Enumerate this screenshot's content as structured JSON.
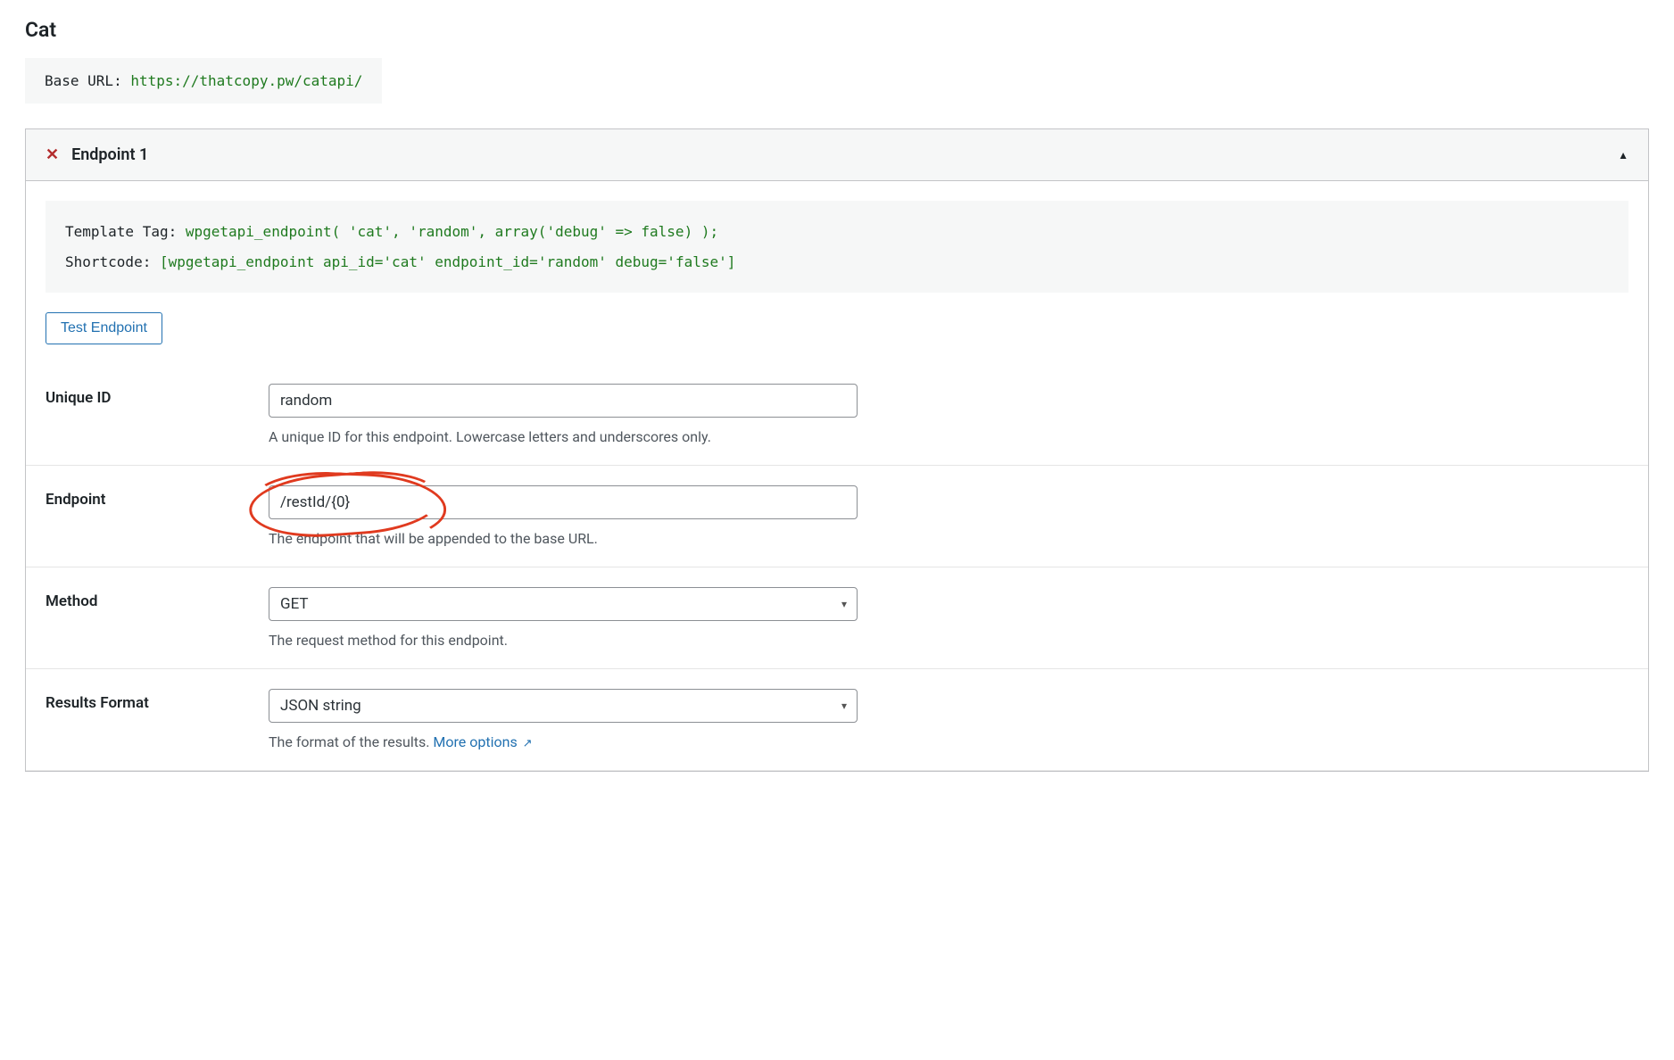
{
  "page_title": "Cat",
  "base_url": {
    "label": "Base URL: ",
    "value": "https://thatcopy.pw/catapi/"
  },
  "endpoint_panel": {
    "title": "Endpoint 1",
    "template_tag": {
      "label": "Template Tag: ",
      "code": "wpgetapi_endpoint( 'cat', 'random', array('debug' => false) );"
    },
    "shortcode": {
      "label": "Shortcode: ",
      "code": "[wpgetapi_endpoint api_id='cat' endpoint_id='random' debug='false']"
    },
    "test_button": "Test Endpoint",
    "fields": {
      "unique_id": {
        "label": "Unique ID",
        "value": "random",
        "help": "A unique ID for this endpoint. Lowercase letters and underscores only."
      },
      "endpoint": {
        "label": "Endpoint",
        "value": "/restId/{0}",
        "help": "The endpoint that will be appended to the base URL."
      },
      "method": {
        "label": "Method",
        "value": "GET",
        "help": "The request method for this endpoint."
      },
      "results_format": {
        "label": "Results Format",
        "value": "JSON string",
        "help": "The format of the results. ",
        "more_link": "More options"
      }
    }
  }
}
